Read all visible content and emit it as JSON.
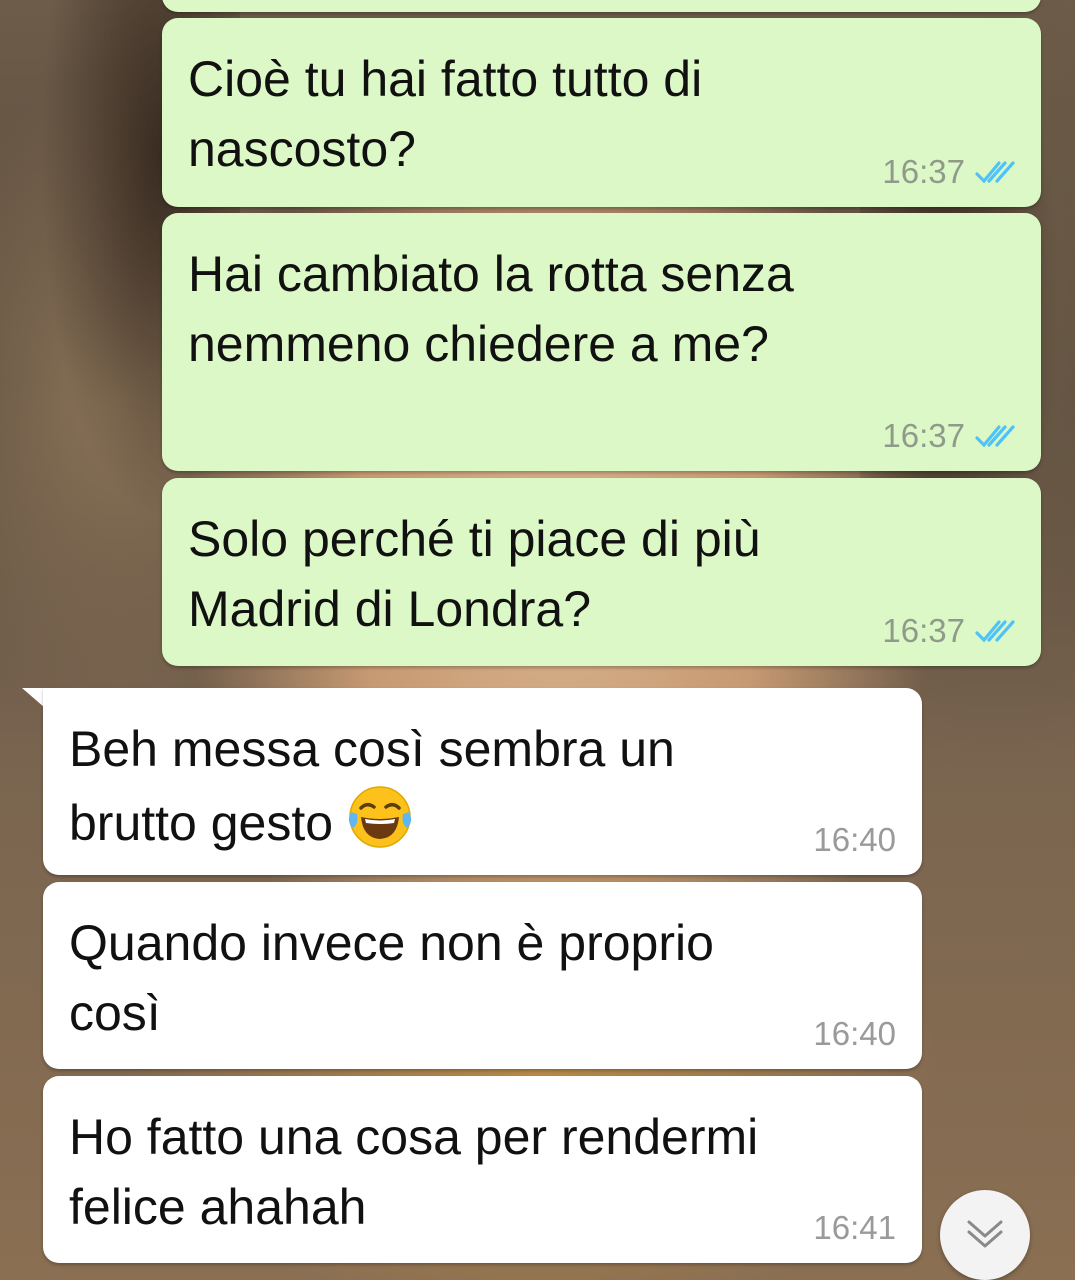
{
  "colors": {
    "outgoing_bubble": "#dcf8c6",
    "incoming_bubble": "#ffffff",
    "read_ticks": "#4fc3f7",
    "timestamp": "#8f9a8a"
  },
  "messages": [
    {
      "direction": "outgoing",
      "text": "Cioè tu hai fatto tutto di\nnascosto?",
      "time": "16:37",
      "status": "read",
      "status_icon": "double-check-icon"
    },
    {
      "direction": "outgoing",
      "text": "Hai cambiato la rotta senza\nnemmeno chiedere a me?",
      "time": "16:37",
      "status": "read",
      "status_icon": "double-check-icon"
    },
    {
      "direction": "outgoing",
      "text": "Solo perché ti piace di più\nMadrid di Londra?",
      "time": "16:37",
      "status": "read",
      "status_icon": "double-check-icon"
    },
    {
      "direction": "incoming",
      "text_line1": "Beh messa così sembra un",
      "text_line2": "brutto gesto",
      "emoji": "face-with-tears-of-joy-icon",
      "time": "16:40"
    },
    {
      "direction": "incoming",
      "text": "Quando invece non è proprio\ncosì",
      "time": "16:40"
    },
    {
      "direction": "incoming",
      "text": "Ho fatto una cosa per rendermi\nfelice ahahah",
      "time": "16:41"
    }
  ],
  "scroll_button": {
    "icon": "double-chevron-down-icon"
  }
}
